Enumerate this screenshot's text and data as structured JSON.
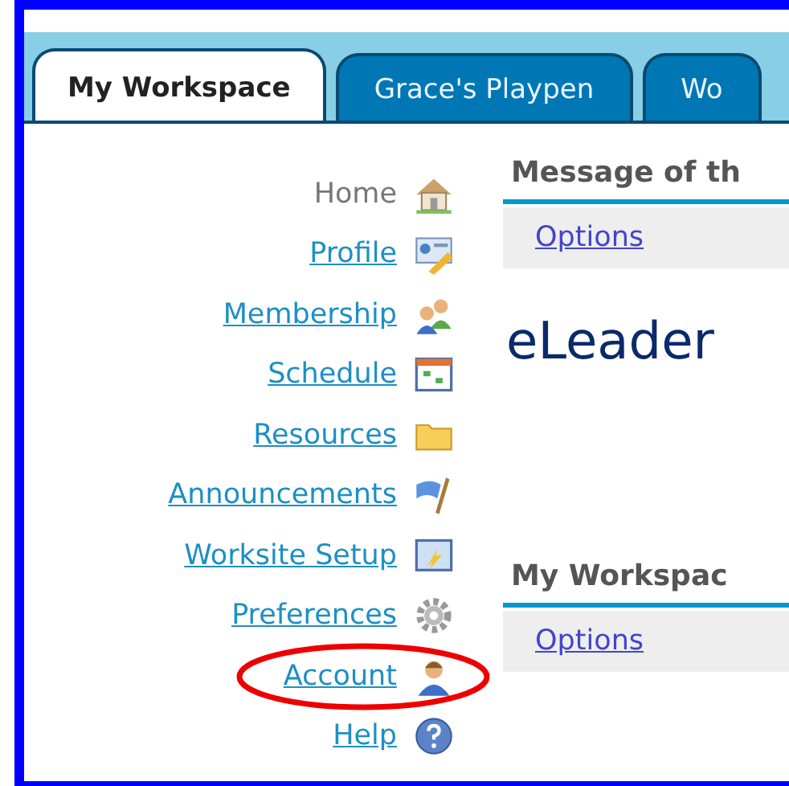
{
  "tabs": [
    {
      "label": "My Workspace",
      "selected": true
    },
    {
      "label": "Grace's Playpen",
      "selected": false
    },
    {
      "label": "Wo",
      "selected": false
    }
  ],
  "sidebar": {
    "items": [
      {
        "label": "Home",
        "selected": true,
        "circled": false
      },
      {
        "label": "Profile",
        "selected": false,
        "circled": false
      },
      {
        "label": "Membership",
        "selected": false,
        "circled": false
      },
      {
        "label": "Schedule",
        "selected": false,
        "circled": false
      },
      {
        "label": "Resources",
        "selected": false,
        "circled": false
      },
      {
        "label": "Announcements",
        "selected": false,
        "circled": false
      },
      {
        "label": "Worksite Setup",
        "selected": false,
        "circled": false
      },
      {
        "label": "Preferences",
        "selected": false,
        "circled": false
      },
      {
        "label": "Account",
        "selected": false,
        "circled": true
      },
      {
        "label": "Help",
        "selected": false,
        "circled": false
      }
    ]
  },
  "panels": [
    {
      "title": "Message of th",
      "options": "Options",
      "message": "eLeader"
    },
    {
      "title": "My Workspac",
      "options": "Options"
    }
  ]
}
